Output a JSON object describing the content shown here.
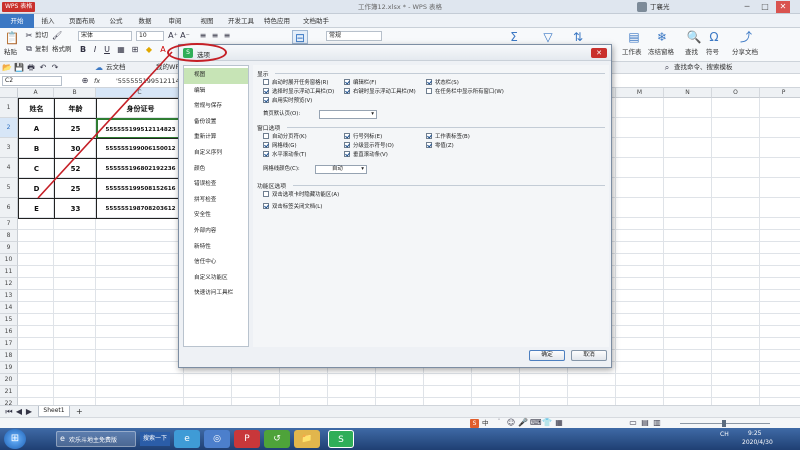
{
  "window": {
    "app_badge": "WPS 表格",
    "title": "工作簿12.xlsx * - WPS 表格",
    "user": "丁襄光",
    "min": "─",
    "max": "□",
    "close": "✕"
  },
  "menu": [
    "开始",
    "插入",
    "页面布局",
    "公式",
    "数据",
    "审阅",
    "视图",
    "开发工具",
    "特色应用",
    "文档助手"
  ],
  "ribbon": {
    "cut": "剪切",
    "copy": "复制",
    "format_painter": "格式刷",
    "paste": "粘贴",
    "font_name": "宋体",
    "font_size": "10",
    "number_format": "常规",
    "worksheet": "工作表",
    "freeze": "冻结窗格",
    "find": "查找",
    "symbol": "符号",
    "share": "分享文档"
  },
  "quickbar": {
    "cloud_doc": "云文档",
    "my_wps": "我的WPS",
    "search_cmd": "查找命令、搜索模板"
  },
  "formula": {
    "name_box": "C2",
    "fx": "fx",
    "content": "'555555199512114823"
  },
  "grid": {
    "columns": [
      "A",
      "B",
      "C",
      "D",
      "E",
      "F",
      "G",
      "H",
      "I",
      "J",
      "K",
      "L",
      "M",
      "N",
      "O",
      "P",
      "Q",
      "R"
    ],
    "rows": [
      "1",
      "2",
      "3",
      "4",
      "5",
      "6",
      "7",
      "8",
      "9",
      "10",
      "11",
      "12",
      "13",
      "14",
      "15",
      "16",
      "17",
      "18",
      "19",
      "20",
      "21",
      "22",
      "23",
      "24",
      "25"
    ],
    "headers": [
      "姓名",
      "年龄",
      "身份证号"
    ],
    "data": [
      [
        "A",
        "25",
        "555555199512114823"
      ],
      [
        "B",
        "30",
        "555555199006150012"
      ],
      [
        "C",
        "52",
        "555555196802192236"
      ],
      [
        "D",
        "25",
        "555555199508152616"
      ],
      [
        "E",
        "33",
        "555555198708203612"
      ]
    ]
  },
  "sheets": {
    "tab": "Sheet1",
    "add": "+"
  },
  "dialog": {
    "title": "选项",
    "close": "✕",
    "sidebar": [
      "视图",
      "编辑",
      "常规与保存",
      "备份设置",
      "重新计算",
      "自定义序列",
      "颜色",
      "错误检查",
      "拼写检查",
      "安全性",
      "外部内容",
      "新特性",
      "信任中心",
      "自定义功能区",
      "快速访问工具栏"
    ],
    "display": {
      "title": "显示",
      "col1": [
        {
          "label": "启动时展开任务窗格(R)",
          "checked": false
        },
        {
          "label": "选择时显示浮动工具栏(D)",
          "checked": true
        },
        {
          "label": "启用实时预览(V)",
          "checked": true
        }
      ],
      "col2": [
        {
          "label": "编辑栏(F)",
          "checked": true
        },
        {
          "label": "右键时显示浮动工具栏(M)",
          "checked": true
        }
      ],
      "col3": [
        {
          "label": "状态栏(S)",
          "checked": true
        },
        {
          "label": "在任务栏中显示所有窗口(W)",
          "checked": false
        }
      ],
      "first_page_label": "首页默认页(O):",
      "first_page_value": ""
    },
    "window_options": {
      "title": "窗口选项",
      "col1": [
        {
          "label": "自动分页符(K)",
          "checked": false
        },
        {
          "label": "网格线(G)",
          "checked": true
        },
        {
          "label": "水平滚动条(T)",
          "checked": true
        }
      ],
      "col2": [
        {
          "label": "行号列标(E)",
          "checked": true
        },
        {
          "label": "分级显示符号(O)",
          "checked": true
        },
        {
          "label": "垂直滚动条(V)",
          "checked": true
        }
      ],
      "col3": [
        {
          "label": "工作表标签(B)",
          "checked": true
        },
        {
          "label": "零值(Z)",
          "checked": true
        }
      ],
      "grid_color_label": "网格线颜色(C):",
      "grid_color_value": "自动"
    },
    "ribbon_options": {
      "title": "功能区选项",
      "items": [
        {
          "label": "双击选项卡时隐藏功能区(A)",
          "checked": false
        },
        {
          "label": "双击标签关闭文档(L)",
          "checked": true
        }
      ]
    },
    "ok": "确定",
    "cancel": "取消"
  },
  "taskbar": {
    "item": "欢乐斗地主免费版",
    "search": "搜索一下",
    "ime": "中",
    "lang": "CH",
    "time": "9:25",
    "date": "2020/4/30"
  },
  "colors": {
    "accent": "#3b78c4",
    "annotation": "#c51f26",
    "selected_side": "#c7e4b6"
  }
}
